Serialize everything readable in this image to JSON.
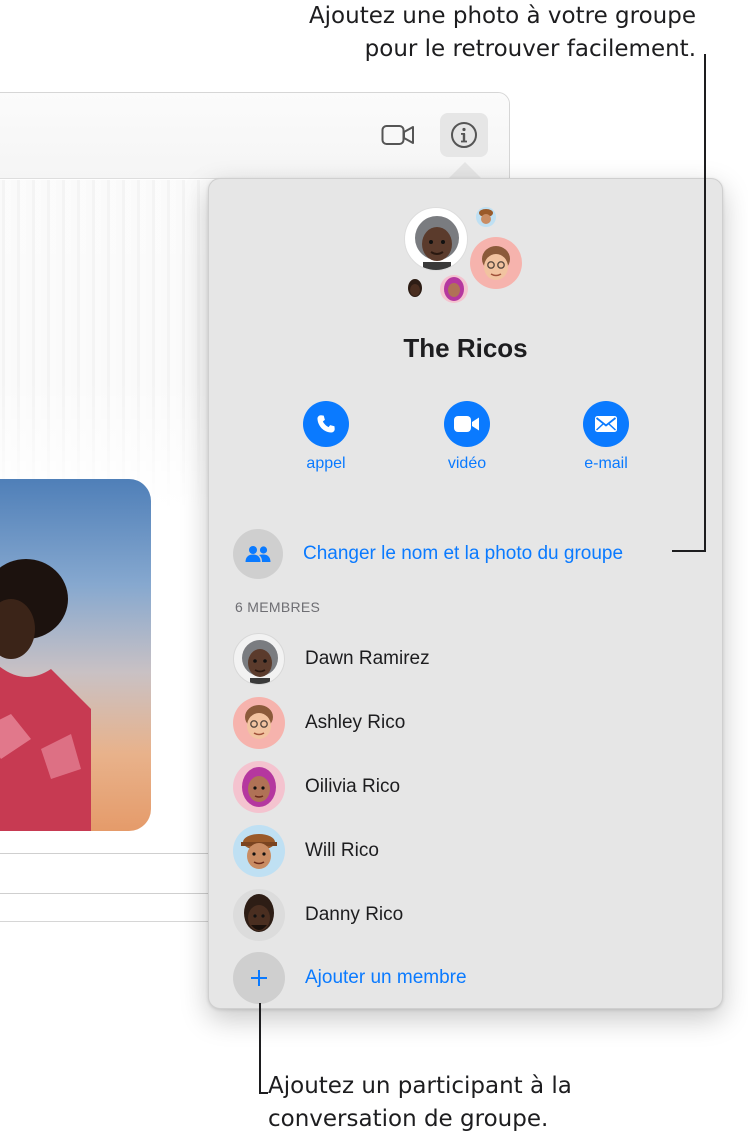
{
  "callouts": {
    "top": [
      "Ajoutez une photo à votre groupe",
      "pour le retrouver facilement."
    ],
    "bottom": [
      "Ajoutez un participant à la",
      "conversation de groupe."
    ]
  },
  "toolbar": {
    "facetime_icon": "video-camera-icon",
    "info_icon": "info-icon"
  },
  "details": {
    "group_name": "The Ricos",
    "actions": [
      {
        "label": "appel",
        "icon": "phone-icon"
      },
      {
        "label": "vidéo",
        "icon": "video-camera-icon"
      },
      {
        "label": "e-mail",
        "icon": "envelope-icon"
      }
    ],
    "change_label": "Changer le nom et la photo du groupe",
    "members_header": "6 MEMBRES",
    "members": [
      {
        "name": "Dawn Ramirez",
        "avatar_bg": "#f2f2f2"
      },
      {
        "name": "Ashley Rico",
        "avatar_bg": "#f6b3ad"
      },
      {
        "name": "Oilivia Rico",
        "avatar_bg": "#f4c3cf"
      },
      {
        "name": "Will Rico",
        "avatar_bg": "#bfe0f3"
      },
      {
        "name": "Danny Rico",
        "avatar_bg": "#dcdcdc"
      }
    ],
    "add_label": "Ajouter un membre"
  },
  "colors": {
    "accent": "#0a7aff",
    "panel": "#e6e6e6"
  }
}
